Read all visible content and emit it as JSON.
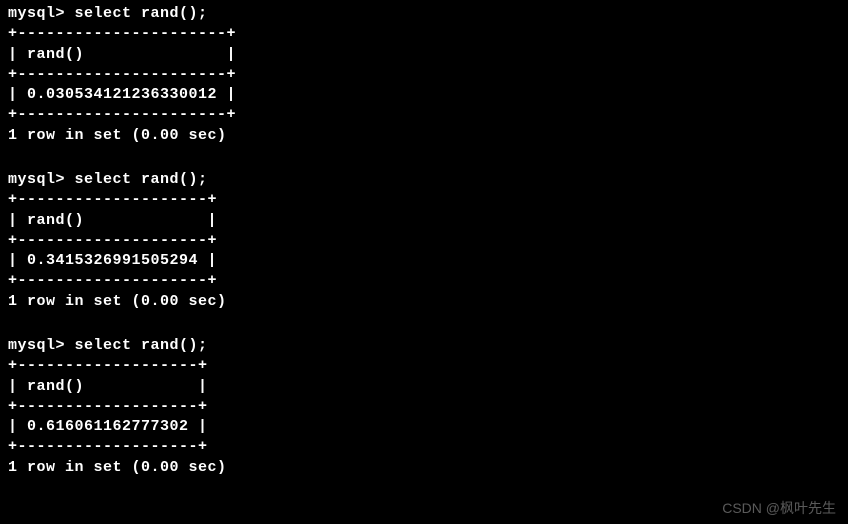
{
  "queries": [
    {
      "prompt": "mysql> ",
      "sql": "select rand();",
      "border_top": "+----------------------+",
      "header": "| rand()               |",
      "border_mid": "+----------------------+",
      "value": "| 0.030534121236330012 |",
      "border_bot": "+----------------------+",
      "status": "1 row in set (0.00 sec)"
    },
    {
      "prompt": "mysql> ",
      "sql": "select rand();",
      "border_top": "+--------------------+",
      "header": "| rand()             |",
      "border_mid": "+--------------------+",
      "value": "| 0.3415326991505294 |",
      "border_bot": "+--------------------+",
      "status": "1 row in set (0.00 sec)"
    },
    {
      "prompt": "mysql> ",
      "sql": "select rand();",
      "border_top": "+-------------------+",
      "header": "| rand()            |",
      "border_mid": "+-------------------+",
      "value": "| 0.616061162777302 |",
      "border_bot": "+-------------------+",
      "status": "1 row in set (0.00 sec)"
    }
  ],
  "watermark": "CSDN @枫叶先生"
}
